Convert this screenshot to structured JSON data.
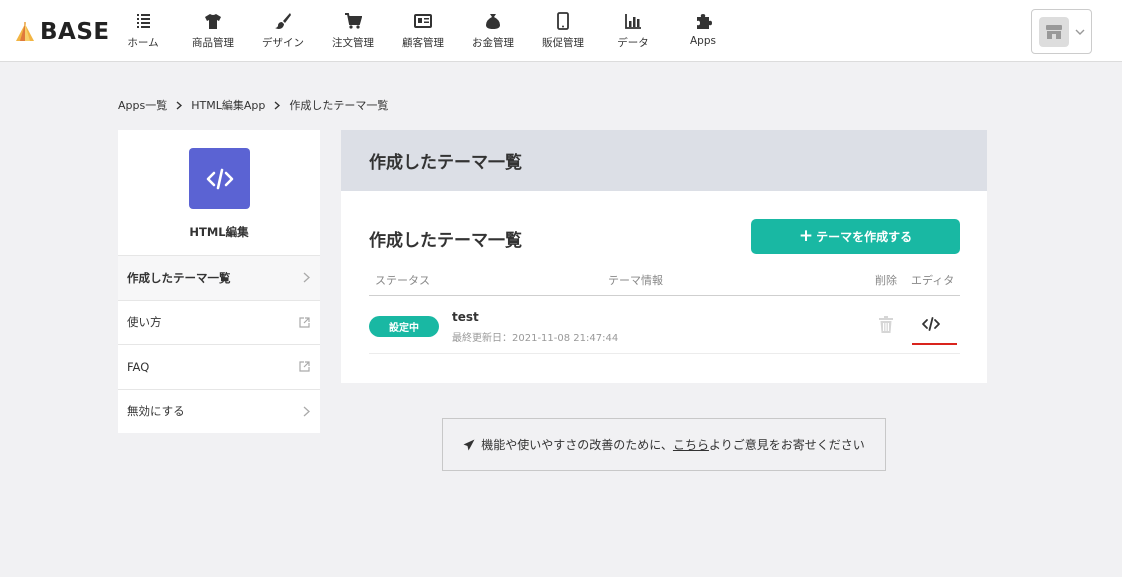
{
  "header": {
    "logo_text": "BASE",
    "nav": [
      {
        "label": "ホーム",
        "icon": "home-list-icon"
      },
      {
        "label": "商品管理",
        "icon": "tshirt-icon"
      },
      {
        "label": "デザイン",
        "icon": "paintbrush-icon"
      },
      {
        "label": "注文管理",
        "icon": "cart-icon"
      },
      {
        "label": "顧客管理",
        "icon": "id-card-icon"
      },
      {
        "label": "お金管理",
        "icon": "money-bag-icon"
      },
      {
        "label": "販促管理",
        "icon": "smartphone-icon"
      },
      {
        "label": "データ",
        "icon": "bar-chart-icon"
      },
      {
        "label": "Apps",
        "icon": "puzzle-icon"
      }
    ],
    "shop_switcher_icon": "store-icon"
  },
  "breadcrumb": {
    "items": [
      "Apps一覧",
      "HTML編集App",
      "作成したテーマ一覧"
    ]
  },
  "sidebar": {
    "app_icon": "code-icon",
    "app_name": "HTML編集",
    "menu": [
      {
        "label": "作成したテーマ一覧",
        "icon": "chevron-right-icon"
      },
      {
        "label": "使い方",
        "icon": "external-link-icon"
      },
      {
        "label": "FAQ",
        "icon": "external-link-icon"
      },
      {
        "label": "無効にする",
        "icon": "chevron-right-icon"
      }
    ]
  },
  "main": {
    "header_title": "作成したテーマ一覧",
    "section_title": "作成したテーマ一覧",
    "create_button": {
      "plus": "+",
      "label": "テーマを作成する"
    },
    "table": {
      "columns": [
        "ステータス",
        "テーマ情報",
        "削除",
        "エディタ"
      ],
      "rows": [
        {
          "status": "設定中",
          "name": "test",
          "updated": "最終更新日：2021-11-08 21:47:44"
        }
      ]
    }
  },
  "feedback": {
    "before": "機能や使いやすさの改善のために、",
    "link": "こちら",
    "after": "よりご意見をお寄せください"
  },
  "colors": {
    "accent": "#19b8a3",
    "app_icon_bg": "#5b63d3",
    "highlight_underline": "#d9241d"
  }
}
